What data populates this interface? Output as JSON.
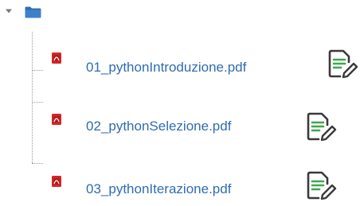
{
  "tree": {
    "toggle_icon": "triangle-down-icon",
    "folder_icon": "folder-icon",
    "folder_color": "#2f6fb0",
    "files": [
      {
        "name": "01_pythonIntroduzione.pdf",
        "type_icon": "pdf-icon",
        "action_icon": "edit-document-icon"
      },
      {
        "name": "02_pythonSelezione.pdf",
        "type_icon": "pdf-icon",
        "action_icon": "edit-document-icon"
      },
      {
        "name": "03_pythonIterazione.pdf",
        "type_icon": "pdf-icon",
        "action_icon": "edit-document-icon"
      }
    ]
  },
  "colors": {
    "link": "#2f6cb2",
    "pdf_red": "#d32626",
    "edit_green": "#3da84a",
    "edit_dark": "#3a3a3a",
    "tree_line": "#9a9a9a"
  }
}
